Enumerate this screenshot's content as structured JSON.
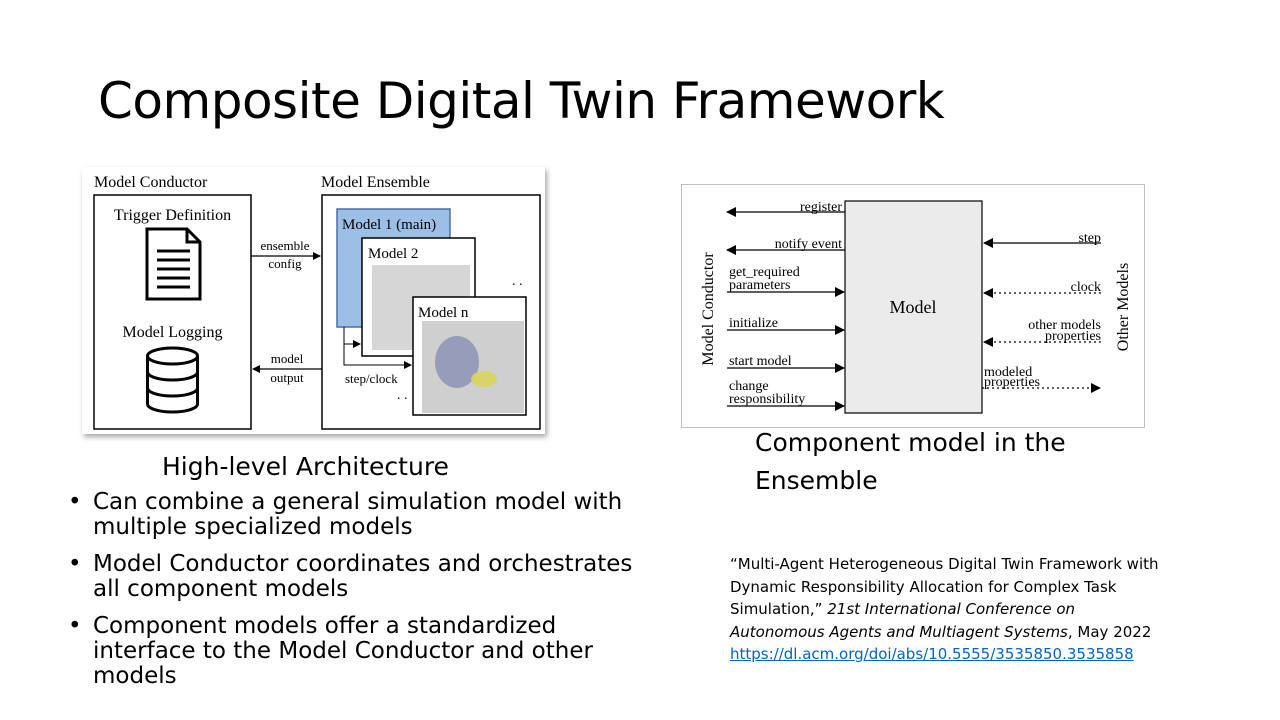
{
  "slide": {
    "title": "Composite Digital Twin Framework"
  },
  "architecture": {
    "conductor_title": "Model Conductor",
    "trigger": "Trigger Definition",
    "logging": "Model Logging",
    "ensemble_title": "Model Ensemble",
    "ensemble_config": [
      "ensemble",
      "config"
    ],
    "model_output": [
      "model",
      "output"
    ],
    "step_clock": "step/clock",
    "model1": "Model 1 (main)",
    "model2": "Model 2",
    "modeln": "Model n",
    "ellipsis": ". .",
    "icons": [
      "document-icon",
      "database-icon"
    ],
    "colors": {
      "model1_fill": "#9dbfe6",
      "model1_stroke": "#4a6fa5"
    }
  },
  "component": {
    "center": "Model",
    "left_axis": "Model  Conductor",
    "right_axis": "Other Models",
    "outputs": [
      "register",
      "notify event"
    ],
    "inputs": [
      [
        "get_required",
        "parameters"
      ],
      [
        "initialize"
      ],
      [
        "start model"
      ],
      [
        "change",
        "responsibility"
      ]
    ],
    "right_inputs": [
      [
        "step"
      ],
      [
        "clock"
      ],
      [
        "other models",
        "properties"
      ]
    ],
    "right_output": [
      "modeled",
      "properties"
    ]
  },
  "captions": {
    "left": "High-level Architecture",
    "right": "Component model in the Ensemble"
  },
  "bullets": [
    "Can combine a general simulation model with multiple specialized models",
    "Model Conductor coordinates and orchestrates all component models",
    "Component models offer a standardized interface to the Model Conductor and other models"
  ],
  "citation": {
    "quote": "“Multi-Agent Heterogeneous Digital Twin Framework with Dynamic Responsibility Allocation for Complex Task Simulation,”",
    "venue": "21st International Conference on Autonomous Agents and Multiagent Systems",
    "date": ", May 2022",
    "url": "https://dl.acm.org/doi/abs/10.5555/3535850.3535858"
  }
}
